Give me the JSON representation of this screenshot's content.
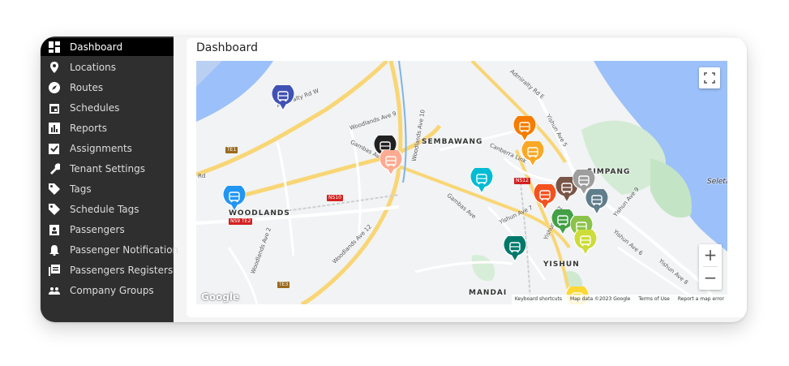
{
  "sidebar": {
    "items": [
      {
        "label": "Dashboard",
        "icon": "dashboard-icon",
        "active": true
      },
      {
        "label": "Locations",
        "icon": "location-pin-icon"
      },
      {
        "label": "Routes",
        "icon": "compass-icon"
      },
      {
        "label": "Schedules",
        "icon": "calendar-icon"
      },
      {
        "label": "Reports",
        "icon": "bar-chart-icon"
      },
      {
        "label": "Assignments",
        "icon": "checkbox-icon"
      },
      {
        "label": "Tenant Settings",
        "icon": "wrench-icon"
      },
      {
        "label": "Tags",
        "icon": "tag-icon"
      },
      {
        "label": "Schedule Tags",
        "icon": "tag-icon"
      },
      {
        "label": "Passengers",
        "icon": "badge-icon"
      },
      {
        "label": "Passenger Notification",
        "icon": "bell-icon"
      },
      {
        "label": "Passengers Registers",
        "icon": "register-book-icon"
      },
      {
        "label": "Company Groups",
        "icon": "group-icon"
      }
    ]
  },
  "main": {
    "title": "Dashboard"
  },
  "map": {
    "places": [
      "SEMBAWANG",
      "WOODLANDS",
      "SIMPANG",
      "YISHUN",
      "MANDAI",
      "Seletar"
    ],
    "roads": [
      "Admiralty Rd W",
      "Woodlands Ave 9",
      "Gambas Ave",
      "Woodlands Ave 10",
      "Admiralty Rd E",
      "Yishun Ave 5",
      "Canberra Link",
      "Gambas Ave",
      "Yishun Ave 7",
      "Yishun Ave 2",
      "Yishun Ave 6",
      "Woodlands Ave 12",
      "Woodlands Ave 2",
      "Yishun Ave 8",
      "Yishun Ave 9",
      "Rd"
    ],
    "stations": [
      "TE1",
      "NS10",
      "NS9 TE2",
      "NS12",
      "TE3"
    ],
    "controls": {
      "fullscreen_icon": "fullscreen-icon",
      "zoom_in": "+",
      "zoom_out": "−"
    },
    "logo": "Google",
    "footer": [
      "Keyboard shortcuts",
      "Map data ©2023 Google",
      "Terms of Use",
      "Report a map error"
    ],
    "marker_colors": [
      "#3f51b5",
      "#212121",
      "#ffab91",
      "#2196f3",
      "#00bcd4",
      "#f57c00",
      "#f9a825",
      "#f4511e",
      "#795548",
      "#9e9e9e",
      "#607d8b",
      "#43a047",
      "#8bc34a",
      "#cddc39",
      "#00796b",
      "#fdd835"
    ],
    "marker_icon": "bus-icon"
  }
}
